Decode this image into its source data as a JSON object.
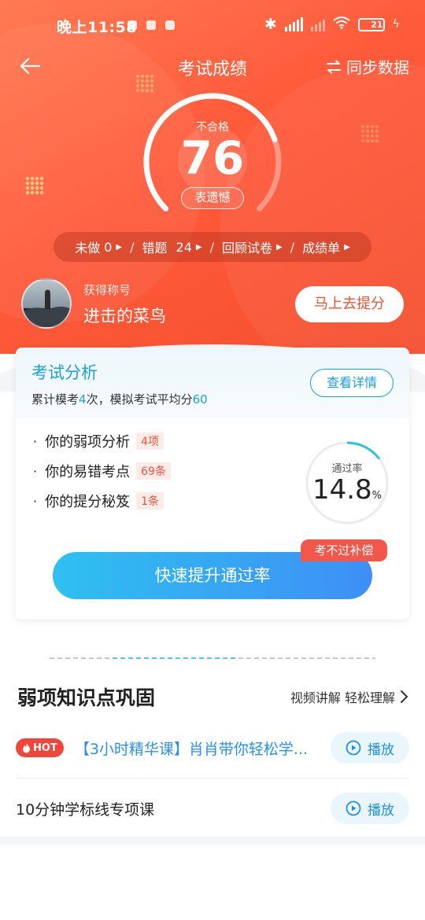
{
  "status_bar": {
    "time": "晚上11:58",
    "battery": "21"
  },
  "nav": {
    "title": "考试成绩",
    "sync_label": "同步数据"
  },
  "score": {
    "status": "不合格",
    "value": "76",
    "badge": "表遗憾",
    "progress": 0.76
  },
  "stats": {
    "unanswered_label": "未做",
    "unanswered": "0",
    "wrong_label": "错题",
    "wrong": "24",
    "review_label": "回顾试卷",
    "report_label": "成绩单"
  },
  "user": {
    "title_label": "获得称号",
    "title_value": "进击的菜鸟",
    "improve_button": "马上去提分"
  },
  "analysis": {
    "title": "考试分析",
    "sub_prefix": "累计模考",
    "mock_count": "4",
    "sub_mid": "次，模拟考试平均分",
    "avg_score": "60",
    "detail_button": "查看详情",
    "items": [
      {
        "label": "你的弱项分析",
        "tag": "4项"
      },
      {
        "label": "你的易错考点",
        "tag": "69条"
      },
      {
        "label": "你的提分秘笈",
        "tag": "1条"
      }
    ],
    "pass_rate_label": "通过率",
    "pass_rate_value": "14.8",
    "pass_rate_unit": "%",
    "pass_rate": 0.148,
    "promo_badge": "考不过补偿",
    "cta_button": "快速提升通过率"
  },
  "weak_section": {
    "title": "弱项知识点巩固",
    "more_label": "视频讲解 轻松理解",
    "courses": [
      {
        "hot": "HOT",
        "title": "【3小时精华课】肖肖带你轻松学...",
        "play": "播放"
      },
      {
        "title": "10分钟学标线专项课",
        "play": "播放"
      }
    ]
  },
  "colors": {
    "hero": "#f4502f",
    "accent_blue": "#1aa0e0",
    "tag_red": "#f0533d"
  }
}
